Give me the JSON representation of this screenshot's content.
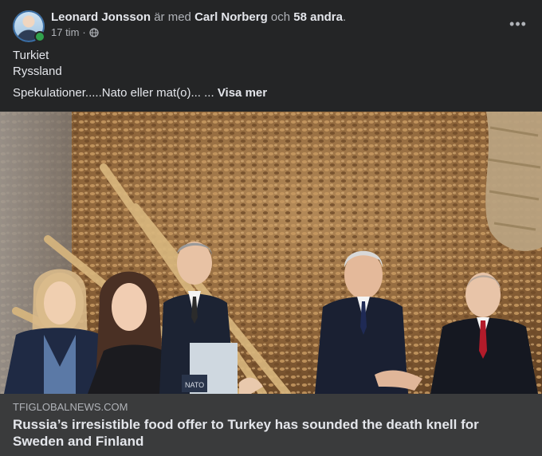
{
  "post": {
    "author": "Leonard Jonsson",
    "with_text": "är med",
    "tagged": "Carl Norberg",
    "and_text": "och",
    "others": "58 andra",
    "period": ".",
    "time": "17 tim",
    "separator": "·",
    "privacy_icon": "globe-icon",
    "more_icon": "more-options-icon",
    "more_label": "•••",
    "lines": [
      "Turkiet",
      "Ryssland"
    ],
    "teaser": "Spekulationer.....Nato eller mat(o)...",
    "ellipsis": "...",
    "see_more": "Visa mer"
  },
  "image": {
    "nato_sign": "NATO"
  },
  "link": {
    "domain": "TFIGLOBALNEWS.COM",
    "headline": "Russia’s irresistible food offer to Turkey has sounded the death knell for Sweden and Finland"
  },
  "colors": {
    "background": "#242526",
    "link_box": "#3a3b3c",
    "primary_text": "#e4e6eb",
    "secondary_text": "#b0b3b8",
    "online": "#31a24c"
  }
}
